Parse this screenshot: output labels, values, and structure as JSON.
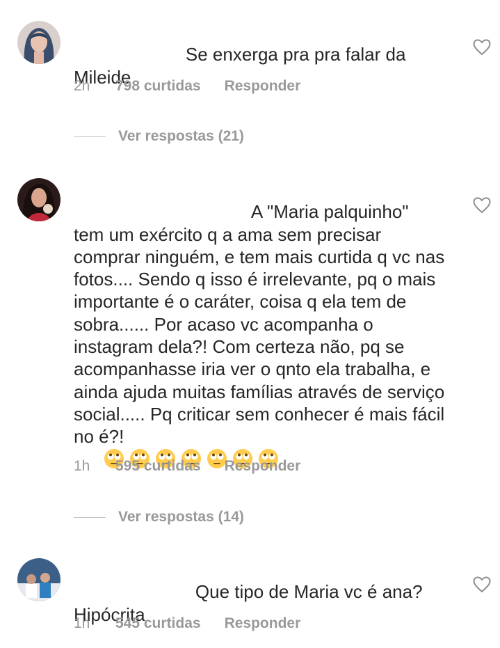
{
  "comments": [
    {
      "avatar": "avatar-woman-blue-hair",
      "text_line1": "Se enxerga pra pra falar da",
      "text_rest": "Mileide",
      "time": "2h",
      "likes": "798 curtidas",
      "reply": "Responder",
      "view_replies": "Ver respostas (21)"
    },
    {
      "avatar": "avatar-woman-dark-hair",
      "text_line1": "A \"Maria palquinho\"",
      "text_rest": "tem um exército q a ama sem precisar comprar ninguém, e tem mais curtida q vc nas fotos.... Sendo q isso é irrelevante, pq o mais importante é o caráter, coisa q ela tem de sobra...... Por acaso vc acompanha o instagram dela?! Com certeza não, pq se acompanhasse iria ver o qnto ela trabalha, e ainda ajuda muitas famílias através de serviço social..... Pq criticar sem conhecer é mais fácil no é?!",
      "emoji_count": 7,
      "emoji_name": "face-with-rolling-eyes-emoji",
      "time": "1h",
      "likes": "595 curtidas",
      "reply": "Responder",
      "view_replies": "Ver respostas (14)"
    },
    {
      "avatar": "avatar-group-photo",
      "text_line1": "Que tipo de Maria vc é ana?",
      "text_rest": "Hipócrita",
      "time": "1h",
      "likes": "545 curtidas",
      "reply": "Responder"
    }
  ],
  "icons": {
    "like": "heart-outline-icon"
  },
  "colors": {
    "text": "#262626",
    "meta": "#999999",
    "divider": "#c7c7c7"
  }
}
